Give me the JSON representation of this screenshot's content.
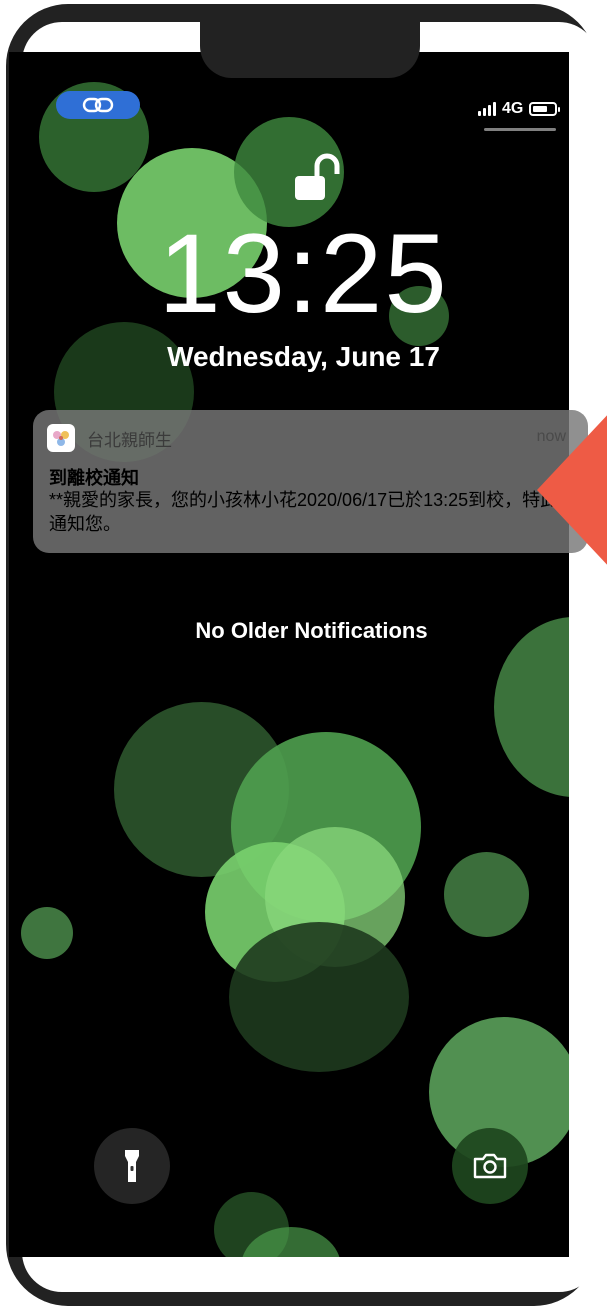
{
  "status_bar": {
    "network": "4G",
    "battery_level_pct": 60,
    "link_pill_color": "#2f6fd6",
    "link_icon": "link-icon"
  },
  "lock_screen": {
    "lock_icon": "unlocked-padlock-icon",
    "time": "13:25",
    "date": "Wednesday, June 17"
  },
  "notification": {
    "app_name": "台北親師生",
    "timestamp": "now",
    "title": "到離校通知",
    "body": "**親愛的家長，您的小孩林小花2020/06/17已於13:25到校，特此通知您。",
    "app_icon": "app-logo-icon"
  },
  "no_older_notifications": "No Older Notifications",
  "quick_actions": {
    "flashlight_icon": "flashlight-icon",
    "camera_icon": "camera-icon"
  },
  "colors": {
    "accent_arrow": "#ee5b45",
    "bokeh_green": "#6ecf6e"
  }
}
